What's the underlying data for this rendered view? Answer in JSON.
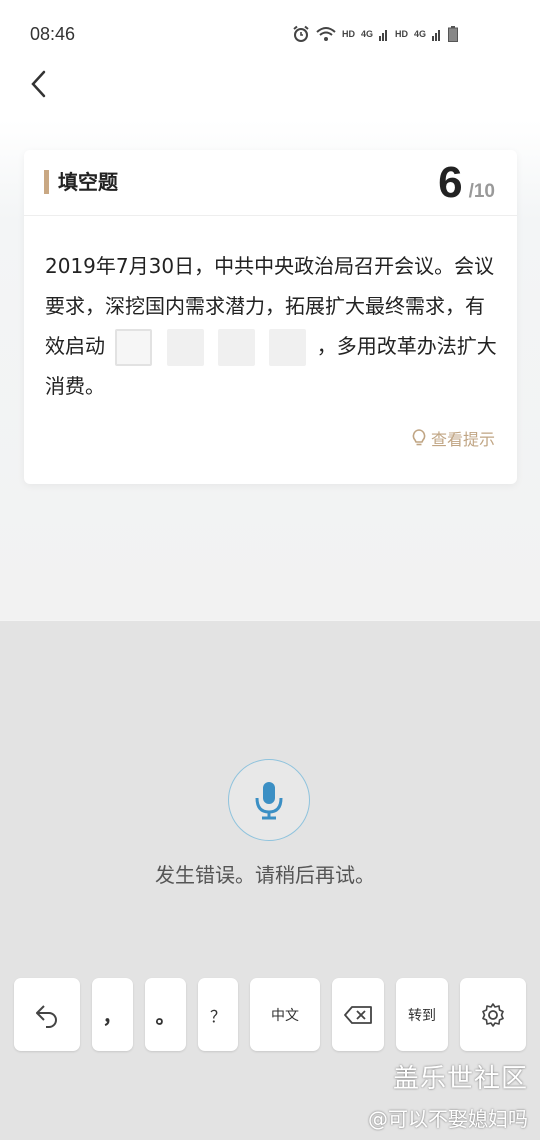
{
  "status_bar": {
    "time": "08:46",
    "hd1": "HD",
    "net1": "4G",
    "hd2": "HD",
    "net2": "4G"
  },
  "card": {
    "title": "填空题",
    "counter_current": "6",
    "counter_total": "/10",
    "question_part1": "2019年7月30日，中共中央政治局召开会议。会议要求，深挖国内需求潜力，拓展扩大最终需求，有效启动",
    "question_part2": "，多用改革办法扩大消费。",
    "hint_label": "查看提示",
    "accent_color": "#c9a883"
  },
  "voice": {
    "message": "发生错误。请稍后再试。"
  },
  "keyboard": {
    "comma": "，",
    "period": "。",
    "question": "？",
    "lang": "中文",
    "switch": "转到"
  },
  "watermark": {
    "line1": "盖乐世社区",
    "line2": "@可以不娶媳妇吗"
  }
}
